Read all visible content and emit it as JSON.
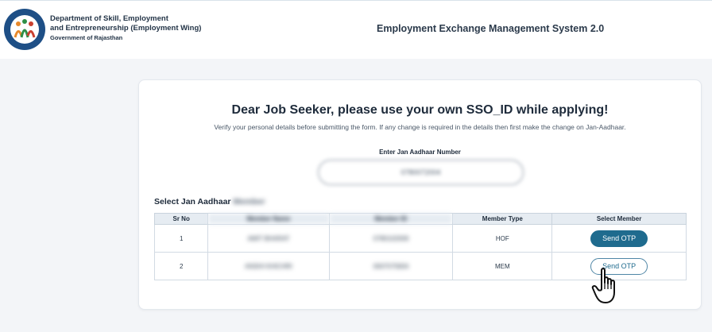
{
  "header": {
    "department_line1": "Department of Skill, Employment",
    "department_line2": "and Entrepreneurship (Employment Wing)",
    "government": "Government of Rajasthan",
    "system_title": "Employment Exchange Management System 2.0"
  },
  "card": {
    "heading": "Dear Job Seeker, please use your own SSO_ID while applying!",
    "subtext": "Verify your personal details before submitting the form. If any change is required in the details then first make the change on Jan-Aadhaar.",
    "aadhaar_label": "Enter Jan Aadhaar Number",
    "aadhaar_value": "0780072004",
    "section_title_prefix": "Select Jan Aadhaar",
    "section_title_blurred": "Member"
  },
  "table": {
    "headers": [
      "Sr No",
      "Member Name",
      "Member ID",
      "Member Type",
      "Select Member"
    ],
    "rows": [
      {
        "sr": "1",
        "name": "AMIT BHARAT",
        "member_id": "0780102009",
        "type": "HOF",
        "action": "Send OTP"
      },
      {
        "sr": "2",
        "name": "ANSHI KHICHRI",
        "member_id": "0007075834",
        "type": "MEM",
        "action": "Send OTP"
      }
    ]
  },
  "colors": {
    "accent": "#1f6b8e",
    "header_bg": "#ffffff",
    "page_bg": "#f3f5f8"
  },
  "icons": {
    "logo": "department-emblem",
    "cursor": "hand-pointer-icon"
  }
}
